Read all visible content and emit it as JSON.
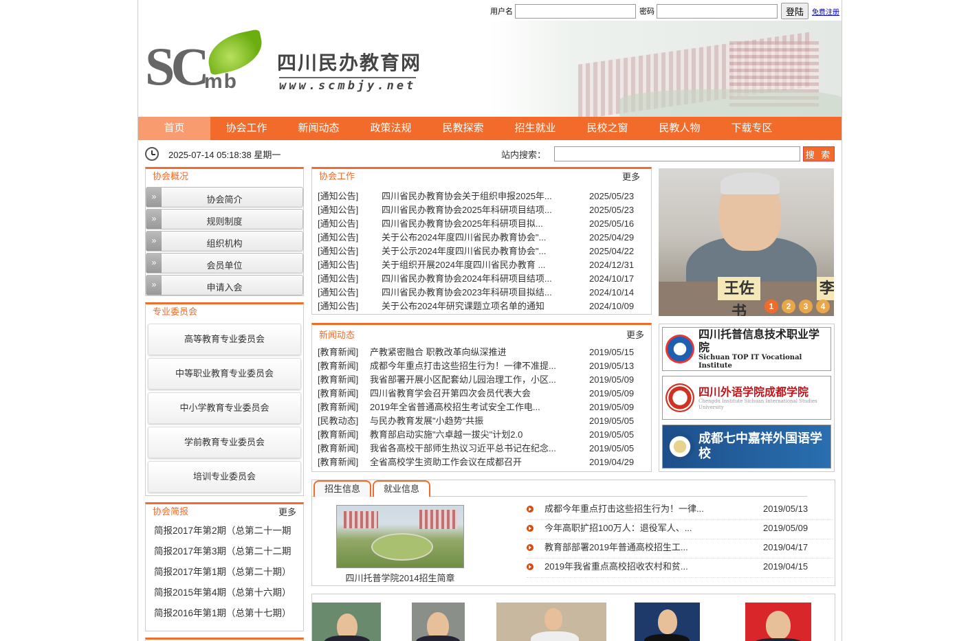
{
  "login": {
    "user_label": "用户名",
    "pass_label": "密码",
    "submit": "登陆",
    "register": "免费注册"
  },
  "header": {
    "logo_letters": "SC",
    "logo_sub": "mb",
    "site_name": "四川民办教育网",
    "site_url": "www.scmbjy.net"
  },
  "nav": [
    "首页",
    "协会工作",
    "新闻动态",
    "政策法规",
    "民教探索",
    "招生就业",
    "民校之窗",
    "民教人物",
    "下载专区"
  ],
  "status": {
    "datetime": "2025-07-14 05:18:38 星期一",
    "search_label": "站内搜索：",
    "search_button": "搜 索"
  },
  "overview": {
    "title": "协会概况",
    "items": [
      "协会简介",
      "规则制度",
      "组织机构",
      "会员单位",
      "申请入会"
    ]
  },
  "committee": {
    "title": "专业委员会",
    "items": [
      "高等教育专业委员会",
      "中等职业教育专业委员会",
      "中小学教育专业委员会",
      "学前教育专业委员会",
      "培训专业委员会"
    ]
  },
  "brief": {
    "title": "协会简报",
    "more": "更多",
    "items": [
      "简报2017年第2期（总第二十一期",
      "简报2017年第3期（总第二十二期",
      "简报2017年第1期（总第二十期）",
      "简报2015年第4期（总第十六期）",
      "简报2016年第1期（总第十七期）"
    ]
  },
  "work": {
    "title": "协会工作",
    "more": "更多",
    "items": [
      {
        "cat": "[通知公告]",
        "title": "四川省民办教育协会关于组织申报2025年...",
        "date": "2025/05/23"
      },
      {
        "cat": "[通知公告]",
        "title": "四川省民办教育协会2025年科研项目结项...",
        "date": "2025/05/23"
      },
      {
        "cat": "[通知公告]",
        "title": "四川省民办教育协会2025年科研项目拟...",
        "date": "2025/05/16"
      },
      {
        "cat": "[通知公告]",
        "title": "关于公布2024年度四川省民办教育协会\"...",
        "date": "2025/04/29"
      },
      {
        "cat": "[通知公告]",
        "title": "关于公示2024年度四川省民办教育协会\"...",
        "date": "2025/04/22"
      },
      {
        "cat": "[通知公告]",
        "title": "关于组织开展2024年度四川省民办教育 ...",
        "date": "2024/12/31"
      },
      {
        "cat": "[通知公告]",
        "title": "四川省民办教育协会2024年科研项目结项...",
        "date": "2024/10/17"
      },
      {
        "cat": "[通知公告]",
        "title": "四川省民办教育协会2023年科研项目拟结...",
        "date": "2024/10/14"
      },
      {
        "cat": "[通知公告]",
        "title": "关于公布2024年研究课题立项名单的通知",
        "date": "2024/10/09"
      }
    ]
  },
  "news": {
    "title": "新闻动态",
    "more": "更多",
    "items": [
      {
        "cat": "[教育新闻]",
        "title": "产教紧密融合 职教改革向纵深推进",
        "date": "2019/05/15"
      },
      {
        "cat": "[教育新闻]",
        "title": "成都今年重点打击这些招生行为！一律不准提...",
        "date": "2019/05/13"
      },
      {
        "cat": "[教育新闻]",
        "title": "我省部署开展小区配套幼儿园治理工作，小区...",
        "date": "2019/05/09"
      },
      {
        "cat": "[教育新闻]",
        "title": "四川省教育学会召开第四次会员代表大会",
        "date": "2019/05/09"
      },
      {
        "cat": "[教育新闻]",
        "title": "2019年全省普通高校招生考试安全工作电...",
        "date": "2019/05/09"
      },
      {
        "cat": "[民教动态]",
        "title": "与民办教育发展\"小趋势\"共振",
        "date": "2019/05/05"
      },
      {
        "cat": "[教育新闻]",
        "title": "教育部启动实施\"六卓越一拔尖\"计划2.0",
        "date": "2019/05/05"
      },
      {
        "cat": "[教育新闻]",
        "title": "我省各高校干部师生热议习近平总书记在纪念...",
        "date": "2019/05/05"
      },
      {
        "cat": "[教育新闻]",
        "title": "全省高校学生资助工作会议在成都召开",
        "date": "2019/04/29"
      }
    ]
  },
  "slider": {
    "nameplate": "王佐书",
    "nameplate2": "李",
    "dots": [
      "1",
      "2",
      "3",
      "4"
    ]
  },
  "partners": [
    {
      "name": "四川托普信息技术职业学院",
      "sub": "Sichuan TOP IT Vocational Institute"
    },
    {
      "name": "四川外语学院成都学院",
      "sub": "Chengdu Institute Sichuan International Studies University"
    },
    {
      "name": "成都七中嘉祥外国语学校",
      "sub": ""
    }
  ],
  "recruit": {
    "tabs": [
      "招生信息",
      "就业信息"
    ],
    "feature_caption": "四川托普学院2014招生简章",
    "items": [
      {
        "title": "成都今年重点打击这些招生行为！一律...",
        "date": "2019/05/13"
      },
      {
        "title": "今年高职扩招100万人：退役军人、...",
        "date": "2019/05/09"
      },
      {
        "title": "教育部部署2019年普通高校招生工...",
        "date": "2019/04/17"
      },
      {
        "title": "2019年我省重点高校招收农村和贫...",
        "date": "2019/04/15"
      }
    ]
  },
  "colors": {
    "accent": "#f36b2b",
    "nav_active": "#f89c6f"
  }
}
